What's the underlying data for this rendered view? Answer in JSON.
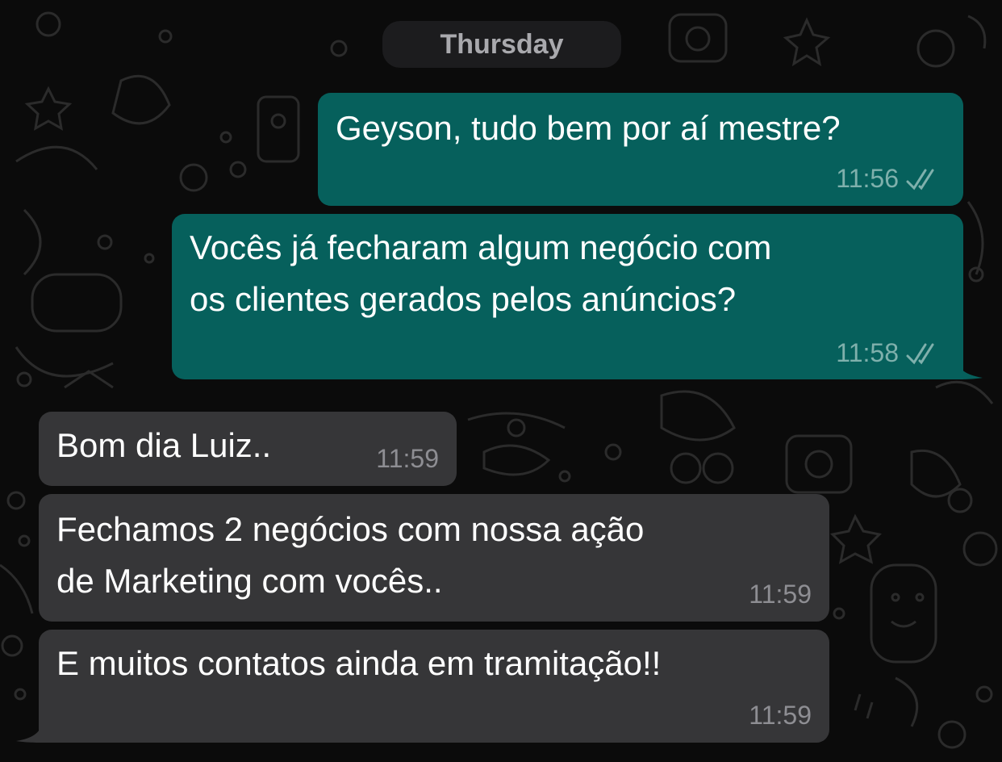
{
  "date_separator": "Thursday",
  "messages": [
    {
      "direction": "outgoing",
      "lines": [
        "Geyson, tudo bem por aí mestre?"
      ],
      "time": "11:56",
      "status": "read-ticks-icon"
    },
    {
      "direction": "outgoing",
      "lines": [
        "Vocês já fecharam algum negócio com",
        "os clientes gerados pelos anúncios?"
      ],
      "time": "11:58",
      "status": "read-ticks-icon"
    },
    {
      "direction": "incoming",
      "lines": [
        "Bom dia Luiz.."
      ],
      "time": "11:59"
    },
    {
      "direction": "incoming",
      "lines": [
        "Fechamos 2 negócios com nossa ação",
        "de Marketing com vocês.."
      ],
      "time": "11:59"
    },
    {
      "direction": "incoming",
      "lines": [
        "E muitos contatos ainda em tramitação!!"
      ],
      "time": "11:59"
    }
  ],
  "colors": {
    "background": "#0b0b0b",
    "outgoing_bubble": "#06605c",
    "incoming_bubble": "#363638",
    "date_chip": "#1c1c1e"
  }
}
